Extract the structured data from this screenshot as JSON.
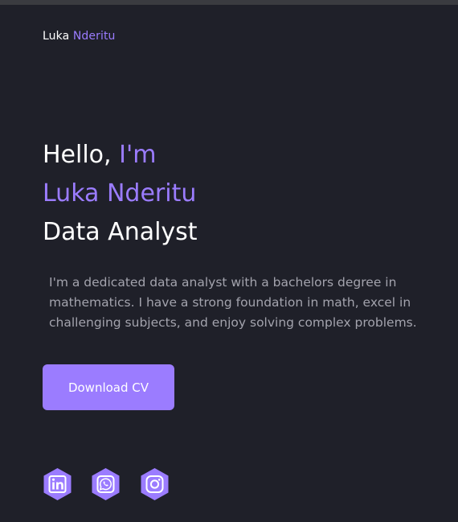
{
  "brand": {
    "first_name": "Luka",
    "last_name": "Nderitu"
  },
  "hero": {
    "greeting": "Hello,",
    "greeting_accent": "I'm",
    "name": "Luka Nderitu",
    "role": "Data Analyst"
  },
  "bio": {
    "text": "I'm a dedicated data analyst with a bachelors degree in mathematics. I have a strong foundation in math, excel in challenging subjects, and enjoy solving complex problems."
  },
  "cta": {
    "label": "Download CV"
  },
  "socials": [
    {
      "icon": "linkedin-icon"
    },
    {
      "icon": "whatsapp-icon"
    },
    {
      "icon": "instagram-icon"
    }
  ],
  "colors": {
    "background": "#1f2029",
    "accent": "#9b7cff",
    "text": "#ffffff",
    "muted_text": "#a3a3ad"
  }
}
